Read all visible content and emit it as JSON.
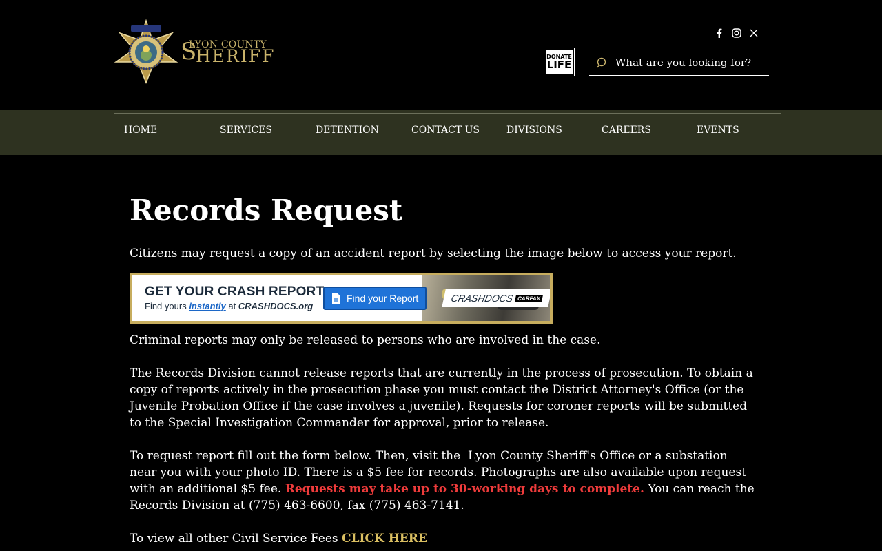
{
  "header": {
    "brand_small": "LYON COUNTY",
    "brand_big_initial": "S",
    "brand_big_rest": "HERIFF",
    "social": [
      "facebook-icon",
      "instagram-icon",
      "x-icon"
    ],
    "donate": {
      "line1": "DONATE",
      "line2": "LIFE"
    },
    "search": {
      "placeholder": "What are you looking for?"
    },
    "colors": {
      "brand_gold": "#c9b36b",
      "nav_bg": "#2e3220"
    }
  },
  "nav": {
    "items": [
      "HOME",
      "SERVICES",
      "DETENTION",
      "CONTACT US",
      "DIVISIONS",
      "CAREERS",
      "EVENTS"
    ]
  },
  "main": {
    "title": "Records Request",
    "intro": "Citizens may request a copy of an accident report by selecting the image below to access your report.",
    "crash_banner": {
      "title": "GET YOUR CRASH REPORT",
      "sub_prefix": "Find yours ",
      "sub_instantly": "instantly",
      "sub_at": " at ",
      "sub_site": "CRASHDOCS.org",
      "button": "Find your Report",
      "logo": "CRASHDOCS",
      "logo_badge": "CARFAX"
    },
    "p_criminal": "Criminal reports may only be released to persons who are involved in the case.",
    "p_prosecution_lines": [
      "The Records Division cannot release reports that are currently in the process of prosecution. To obtain a",
      "copy of reports actively in the prosecution phase you must contact the District Attorney's Office (or the",
      "Juvenile Probation Office if the case involves a juvenile). Requests for coroner reports will be submitted",
      "to the Special Investigation Commander for approval, prior to release."
    ],
    "p_request": {
      "line1": "To request report fill out the form below. Then, visit the  Lyon County Sheriff's Office or a substation",
      "line2": "near you with your photo ID. There is a $5 fee for records. Photographs are also available upon request",
      "line3_a": "with an additional $5 fee. ",
      "line3_red": "Requests may take up to 30-working days to complete.",
      "line3_b": " You can reach the",
      "line4": "Records Division at (775) 463-6600, fax (775) 463-7141."
    },
    "fees": {
      "text": "To view all other Civil Service Fees ",
      "link": "CLICK HERE"
    }
  }
}
